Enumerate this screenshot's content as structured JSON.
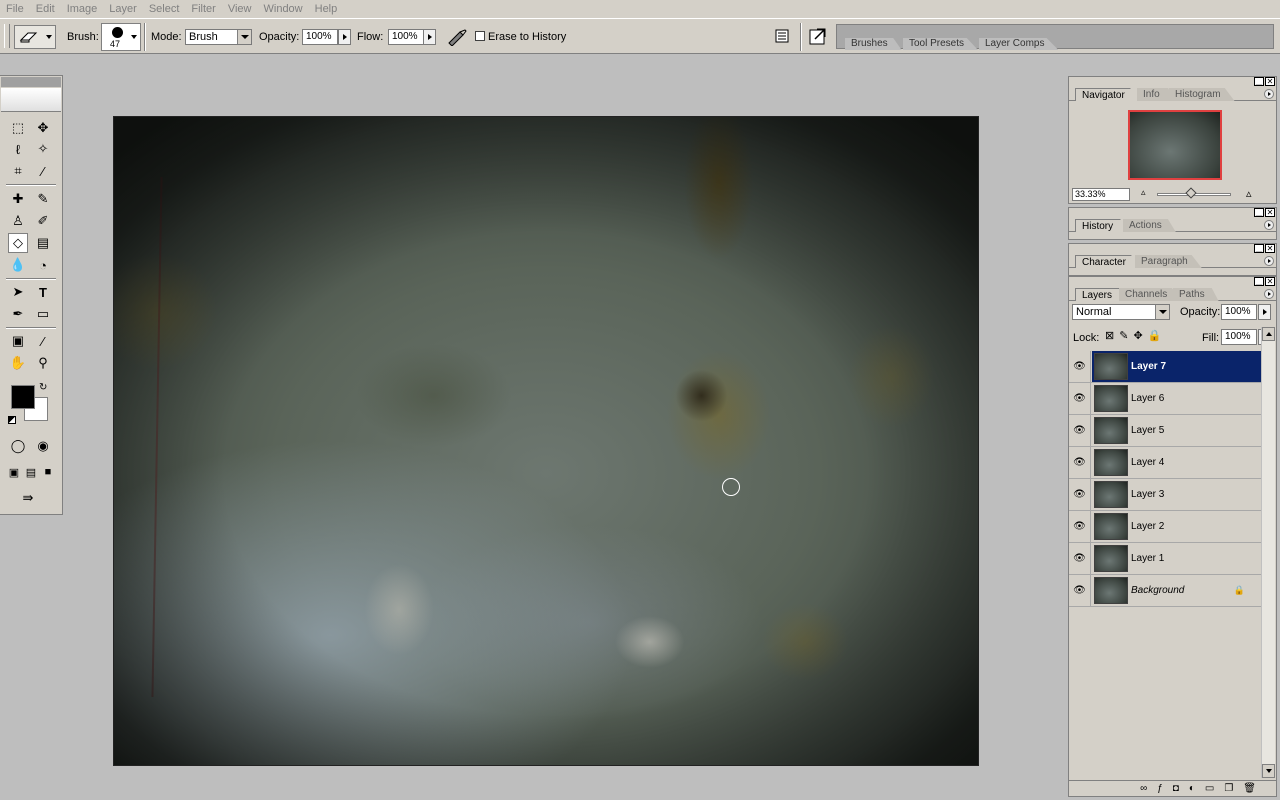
{
  "menu": [
    "File",
    "Edit",
    "Image",
    "Layer",
    "Select",
    "Filter",
    "View",
    "Window",
    "Help"
  ],
  "options": {
    "brush_label": "Brush:",
    "brush_size": "47",
    "mode_label": "Mode:",
    "mode_value": "Brush",
    "opacity_label": "Opacity:",
    "opacity_value": "100%",
    "flow_label": "Flow:",
    "flow_value": "100%",
    "erase_to_history": "Erase to History"
  },
  "palette_well": {
    "tabs": [
      "Brushes",
      "Tool Presets",
      "Layer Comps"
    ]
  },
  "navigator": {
    "tabs": [
      "Navigator",
      "Info",
      "Histogram"
    ],
    "zoom": "33.33%"
  },
  "history": {
    "tabs": [
      "History",
      "Actions"
    ]
  },
  "character": {
    "tabs": [
      "Character",
      "Paragraph"
    ]
  },
  "layers": {
    "tabs": [
      "Layers",
      "Channels",
      "Paths"
    ],
    "blend_mode": "Normal",
    "opacity_label": "Opacity:",
    "opacity": "100%",
    "lock_label": "Lock:",
    "fill_label": "Fill:",
    "fill": "100%",
    "items": [
      {
        "name": "Layer 7"
      },
      {
        "name": "Layer 6"
      },
      {
        "name": "Layer 5"
      },
      {
        "name": "Layer 4"
      },
      {
        "name": "Layer 3"
      },
      {
        "name": "Layer 2"
      },
      {
        "name": "Layer 1"
      },
      {
        "name": "Background"
      }
    ]
  },
  "colors": {
    "selection": "#0a246a",
    "foreground": "#000000",
    "background": "#ffffff"
  }
}
